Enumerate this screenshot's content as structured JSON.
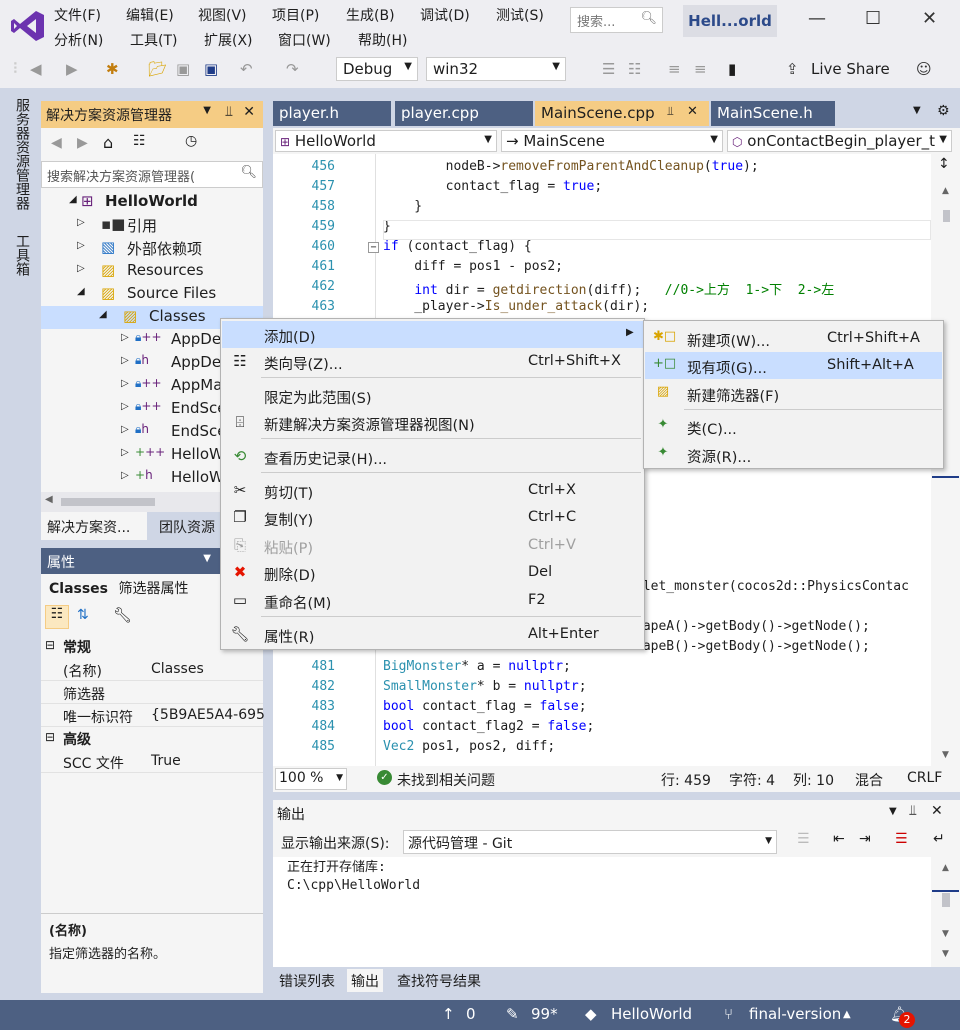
{
  "menubar": {
    "row1": [
      "文件(F)",
      "编辑(E)",
      "视图(V)",
      "项目(P)",
      "生成(B)",
      "调试(D)",
      "测试(S)"
    ],
    "row2": [
      "分析(N)",
      "工具(T)",
      "扩展(X)",
      "窗口(W)",
      "帮助(H)"
    ],
    "search_placeholder": "搜索...",
    "solution_title": "Hell...orld"
  },
  "toolbar": {
    "config": "Debug",
    "platform": "win32",
    "live_share": "Live Share"
  },
  "left_strip": {
    "tab1": "服务器资源管理器",
    "tab2": "工具箱"
  },
  "solution_explorer": {
    "title": "解决方案资源管理器",
    "search_placeholder": "搜索解决方案资源管理器(",
    "tree": [
      {
        "label": "HelloWorld",
        "bold": true
      },
      {
        "label": "引用"
      },
      {
        "label": "外部依赖项"
      },
      {
        "label": "Resources"
      },
      {
        "label": "Source Files"
      },
      {
        "label": "Classes"
      },
      {
        "label": "AppDe"
      },
      {
        "label": "AppDe"
      },
      {
        "label": "AppMa"
      },
      {
        "label": "EndSce"
      },
      {
        "label": "EndSce"
      },
      {
        "label": "HelloW"
      },
      {
        "label": "HelloW"
      }
    ],
    "tab_solution": "解决方案资...",
    "tab_team": "团队资源"
  },
  "properties": {
    "title": "属性",
    "object_name": "Classes",
    "object_type": "筛选器属性",
    "section_general": "常规",
    "rows": [
      {
        "name": "(名称)",
        "value": "Classes"
      },
      {
        "name": "筛选器",
        "value": ""
      },
      {
        "name": "唯一标识符",
        "value": "{5B9AE5A4-695"
      }
    ],
    "section_advanced": "高级",
    "scc_name": "SCC 文件",
    "scc_value": "True",
    "desc_title": "(名称)",
    "desc_text": "指定筛选器的名称。"
  },
  "editor": {
    "tabs": [
      "player.h",
      "player.cpp",
      "MainScene.cpp",
      "MainScene.h"
    ],
    "active_tab": "MainScene.cpp",
    "nav_project": "HelloWorld",
    "nav_class": "MainScene",
    "nav_member": "onContactBegin_player_t",
    "lines_top": [
      {
        "n": "456",
        "html": "        nodeB-><span class=\"fn\">removeFromParentAndCleanup</span>(<span class=\"kw\">true</span>);"
      },
      {
        "n": "457",
        "html": "        contact_flag = <span class=\"kw\">true</span>;"
      },
      {
        "n": "458",
        "html": "    }"
      },
      {
        "n": "459",
        "html": "}"
      },
      {
        "n": "460",
        "html": "<span class=\"kw\">if</span> (contact_flag) {"
      },
      {
        "n": "461",
        "html": "    diff = pos1 - pos2;"
      },
      {
        "n": "462",
        "html": "    <span class=\"kw\">int</span> dir = <span class=\"fn\">getdirection</span>(diff);   <span class=\"cm\">//0->上方  1->下  2->左</span>"
      },
      {
        "n": "463",
        "html": "    _player-><span class=\"fn\">Is_under_attack</span>(dir);"
      }
    ],
    "line_mid1": "llet_monster(cocos2d::PhysicsContac",
    "line_mid2": "hapeA()->getBody()->getNode();",
    "line_480_tail": "hapeB()->getBody()->getNode();",
    "lines_bottom": [
      {
        "n": "481",
        "html": "<span class=\"ty\">BigMonster</span>* a = <span class=\"kw\">nullptr</span>;"
      },
      {
        "n": "482",
        "html": "<span class=\"ty\">SmallMonster</span>* b = <span class=\"kw\">nullptr</span>;"
      },
      {
        "n": "483",
        "html": "<span class=\"kw\">bool</span> contact_flag = <span class=\"kw\">false</span>;"
      },
      {
        "n": "484",
        "html": "<span class=\"kw\">bool</span> contact_flag2 = <span class=\"kw\">false</span>;"
      },
      {
        "n": "485",
        "html": "<span class=\"ty\">Vec2</span> pos1, pos2, diff;"
      }
    ],
    "zoom": "100 %",
    "issues": "未找到相关问题",
    "row": "行: 459",
    "char": "字符: 4",
    "col": "列: 10",
    "mixed": "混合",
    "eol": "CRLF"
  },
  "output": {
    "title": "输出",
    "source_label": "显示输出来源(S):",
    "source_value": "源代码管理 - Git",
    "text": "正在打开存储库:\nC:\\cpp\\HelloWorld",
    "tabs": [
      "错误列表",
      "输出",
      "查找符号结果"
    ]
  },
  "context_menu": {
    "add": "添加(D)",
    "class_wizard": "类向导(Z)...",
    "class_wizard_sc": "Ctrl+Shift+X",
    "scope": "限定为此范围(S)",
    "new_view": "新建解决方案资源管理器视图(N)",
    "history": "查看历史记录(H)...",
    "cut": "剪切(T)",
    "cut_sc": "Ctrl+X",
    "copy": "复制(Y)",
    "copy_sc": "Ctrl+C",
    "paste": "粘贴(P)",
    "paste_sc": "Ctrl+V",
    "delete": "删除(D)",
    "delete_sc": "Del",
    "rename": "重命名(M)",
    "rename_sc": "F2",
    "properties": "属性(R)",
    "properties_sc": "Alt+Enter"
  },
  "submenu": {
    "new_item": "新建项(W)...",
    "new_item_sc": "Ctrl+Shift+A",
    "existing_item": "现有项(G)...",
    "existing_item_sc": "Shift+Alt+A",
    "new_filter": "新建筛选器(F)",
    "class": "类(C)...",
    "resource": "资源(R)..."
  },
  "statusbar": {
    "up_count": "0",
    "edits": "99*",
    "repo": "HelloWorld",
    "branch": "final-version",
    "notifications": "2"
  }
}
